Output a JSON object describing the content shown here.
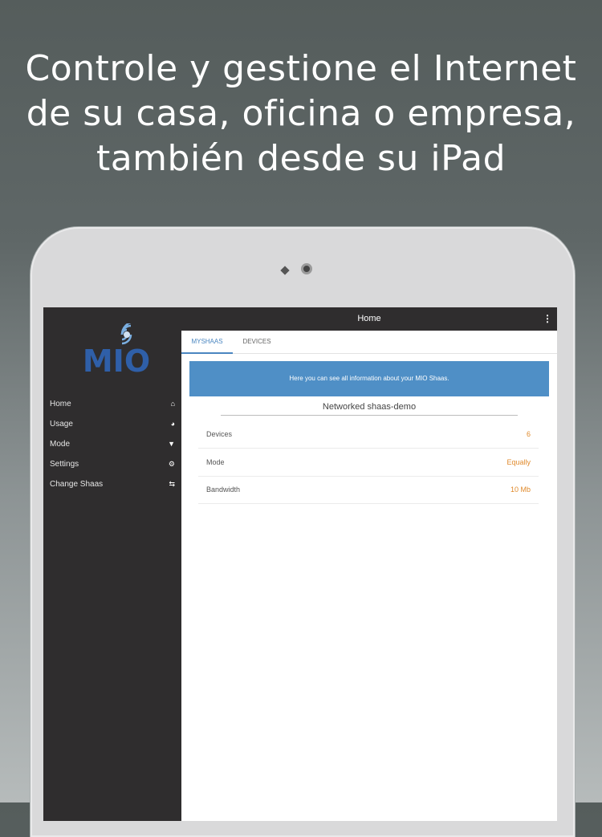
{
  "headline": {
    "lines": [
      "Controle y gestione el Internet",
      "de su casa, oficina o empresa,",
      "también desde su iPad"
    ]
  },
  "app": {
    "logo_text": "MIO",
    "topbar_title": "Home",
    "tabs": [
      {
        "label": "MYSHAAS",
        "active": true
      },
      {
        "label": "DEVICES",
        "active": false
      }
    ],
    "sidebar": {
      "items": [
        {
          "label": "Home",
          "icon": "home-icon"
        },
        {
          "label": "Usage",
          "icon": "pie-chart-icon"
        },
        {
          "label": "Mode",
          "icon": "filter-icon"
        },
        {
          "label": "Settings",
          "icon": "gear-icon"
        },
        {
          "label": "Change Shaas",
          "icon": "swap-arrows-icon"
        }
      ]
    },
    "info_banner": "Here you can see all information about your MIO Shaas.",
    "network_name": "Networked shaas-demo",
    "details": [
      {
        "label": "Devices",
        "value": "6"
      },
      {
        "label": "Mode",
        "value": "Equally"
      },
      {
        "label": "Bandwidth",
        "value": "10 Mb"
      }
    ]
  },
  "colors": {
    "accent": "#4f8fc6",
    "value_orange": "#e08a2c",
    "sidebar_bg": "#2f2d2e",
    "logo_blue": "#2f5fa8"
  }
}
